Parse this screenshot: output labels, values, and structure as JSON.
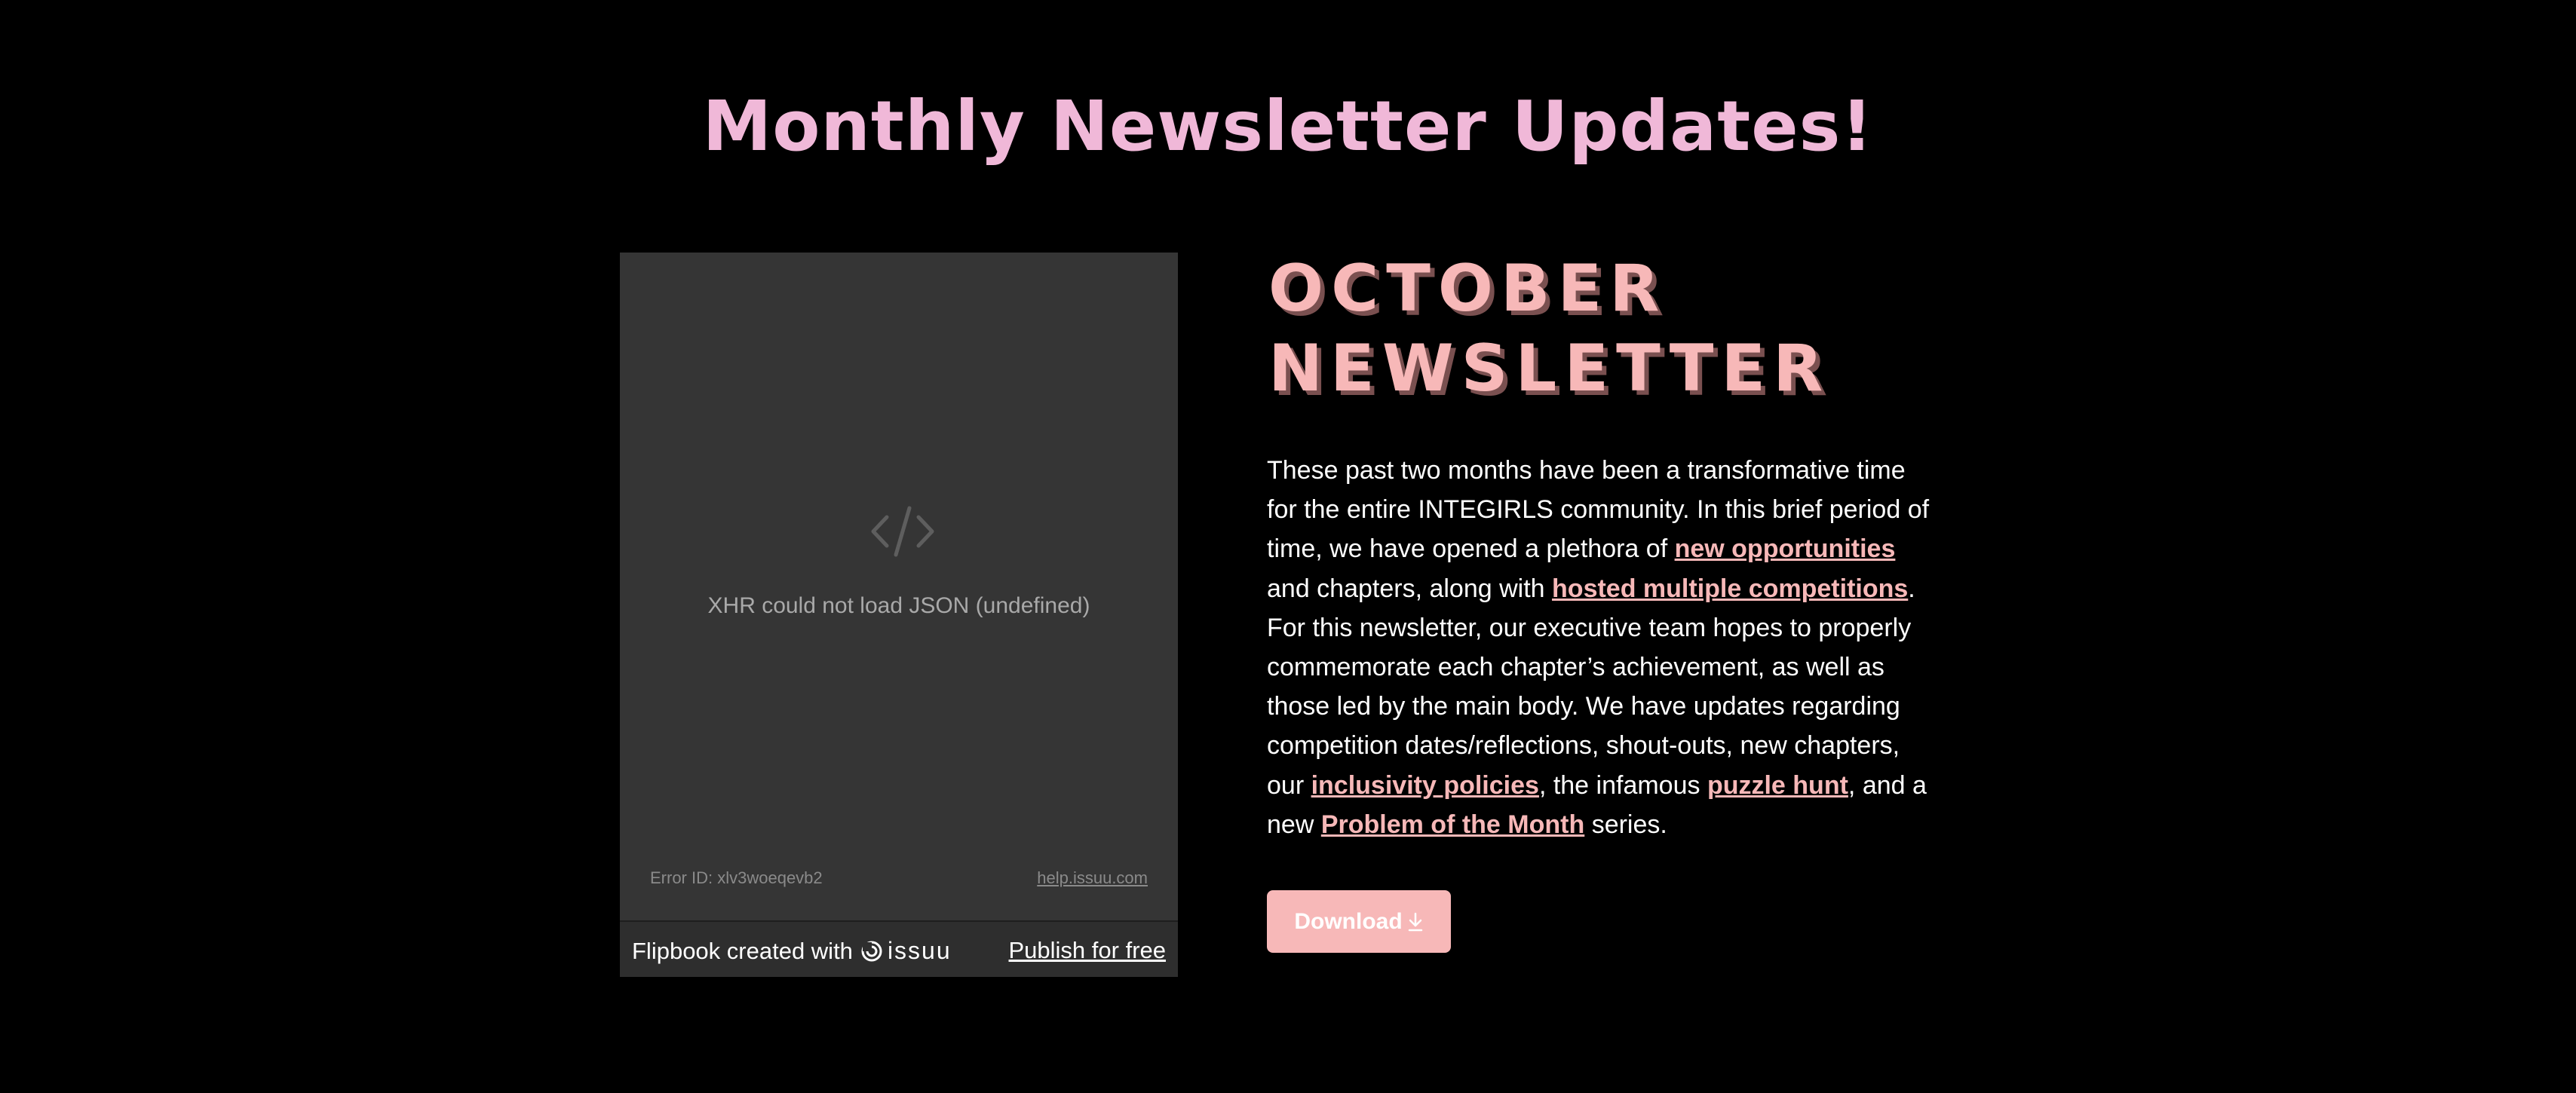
{
  "page": {
    "title": "Monthly Newsletter Updates!"
  },
  "flipbook": {
    "error_message": "XHR could not load JSON (undefined)",
    "error_id": "Error ID: xlv3woeqevb2",
    "help_link": "help.issuu.com",
    "footer_text": "Flipbook created with",
    "brand": "issuu",
    "publish_link": "Publish for free"
  },
  "newsletter": {
    "heading_line1": "OCTOBER",
    "heading_line2": "NEWSLETTER",
    "text_1": "These past two months have been a transformative time for the entire INTEGIRLS community. In this brief period of time, we have opened a plethora of ",
    "link_opportunities": "new opportunities",
    "text_2": " and chapters, along with ",
    "link_competitions": "hosted multiple competitions",
    "text_3": ". For this newsletter, our executive team hopes to properly commemorate each chapter’s achievement, as well as those led by the main body. We have updates regarding competition dates/reflections, shout-outs, new chapters, our ",
    "link_inclusivity": "inclusivity policies",
    "text_4": ", the infamous ",
    "link_puzzle": "puzzle hunt",
    "text_5": ", and a new ",
    "link_potm": "Problem of the Month",
    "text_6": " series.",
    "download_label": "Download",
    "download_icon": "download-arrow-icon"
  },
  "colors": {
    "background": "#000000",
    "title_pink": "#f0b8d8",
    "accent_pink": "#f7b8b8",
    "embed_gray": "#353535"
  }
}
